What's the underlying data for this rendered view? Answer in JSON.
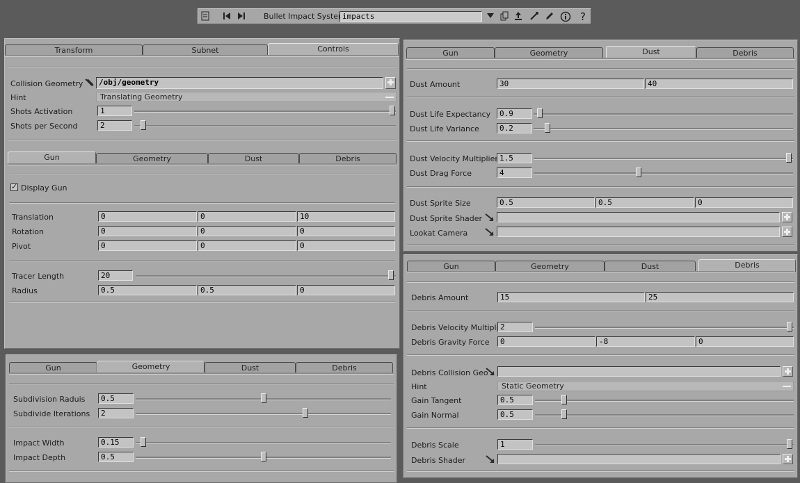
{
  "toolbar": {
    "node_type": "Bullet Impact System",
    "node_name": "impacts",
    "icons": [
      "network-icon",
      "first-icon",
      "last-icon",
      "dropdown-icon",
      "copy-icon",
      "upload-icon",
      "pipette-icon",
      "pencil-icon",
      "info-icon",
      "help-icon"
    ],
    "help_label": "?"
  },
  "main": {
    "tabs": [
      "Transform",
      "Subnet",
      "Controls"
    ],
    "active_tab": "Controls",
    "collision_geometry": {
      "label": "Collision Geometry",
      "value": "/obj/geometry"
    },
    "hint": {
      "label": "Hint",
      "value": "Translating Geometry"
    },
    "shots_activation": {
      "label": "Shots Activation",
      "value": "1",
      "level": 1.0
    },
    "shots_per_second": {
      "label": "Shots per Second",
      "value": "2",
      "level": 0.03
    }
  },
  "gun_panel": {
    "tabs": [
      "Gun",
      "Geometry",
      "Dust",
      "Debris"
    ],
    "active_tab": "Gun",
    "display_gun": {
      "label": "Display Gun",
      "checked": true,
      "mark": "✓"
    },
    "translation": {
      "label": "Translation",
      "values": [
        "0",
        "0",
        "10"
      ]
    },
    "rotation": {
      "label": "Rotation",
      "values": [
        "0",
        "0",
        "0"
      ]
    },
    "pivot": {
      "label": "Pivot",
      "values": [
        "0",
        "0",
        "0"
      ]
    },
    "tracer_length": {
      "label": "Tracer Length",
      "value": "20",
      "level": 1.0
    },
    "radius": {
      "label": "Radius",
      "values": [
        "0.5",
        "0.5",
        "0"
      ]
    }
  },
  "geometry_panel": {
    "tabs": [
      "Gun",
      "Geometry",
      "Dust",
      "Debris"
    ],
    "active_tab": "Geometry",
    "subdivision_radius": {
      "label": "Subdivision Raduis",
      "value": "0.5",
      "level": 0.5
    },
    "subdivide_iterations": {
      "label": "Subdivide Iterations",
      "value": "2",
      "level": 0.67
    },
    "impact_width": {
      "label": "Impact Width",
      "value": "0.15",
      "level": 0.02
    },
    "impact_depth": {
      "label": "Impact Depth",
      "value": "0.5",
      "level": 0.5
    }
  },
  "dust_panel": {
    "tabs": [
      "Gun",
      "Geometry",
      "Dust",
      "Debris"
    ],
    "active_tab": "Dust",
    "dust_amount": {
      "label": "Dust Amount",
      "values": [
        "30",
        "40"
      ]
    },
    "life_expectancy": {
      "label": "Dust Life Expectancy",
      "value": "0.9",
      "level": 0.02
    },
    "life_variance": {
      "label": "Dust Life Variance",
      "value": "0.2",
      "level": 0.05
    },
    "velocity_multiplier": {
      "label": "Dust Velocity Multiplier",
      "value": "1.5",
      "level": 1.0
    },
    "drag_force": {
      "label": "Dust Drag Force",
      "value": "4",
      "level": 0.4
    },
    "sprite_size": {
      "label": "Dust Sprite Size",
      "values": [
        "0.5",
        "0.5",
        "0"
      ]
    },
    "sprite_shader": {
      "label": "Dust Sprite Shader",
      "value": ""
    },
    "lookat_camera": {
      "label": "Lookat Camera",
      "value": ""
    }
  },
  "debris_panel": {
    "tabs": [
      "Gun",
      "Geometry",
      "Dust",
      "Debris"
    ],
    "active_tab": "Debris",
    "debris_amount": {
      "label": "Debris Amount",
      "values": [
        "15",
        "25"
      ]
    },
    "velocity_multiplier": {
      "label": "Debris Velocity Multiplier",
      "value": "2",
      "level": 1.0
    },
    "gravity_force": {
      "label": "Debris Gravity Force",
      "values": [
        "0",
        "-8",
        "0"
      ]
    },
    "collision_geo": {
      "label": "Debris Collision Geo",
      "value": ""
    },
    "hint": {
      "label": "Hint",
      "value": "Static Geometry"
    },
    "gain_tangent": {
      "label": "Gain Tangent",
      "value": "0.5",
      "level": 0.1
    },
    "gain_normal": {
      "label": "Gain Normal",
      "value": "0.5",
      "level": 0.1
    },
    "debris_scale": {
      "label": "Debris Scale",
      "value": "1",
      "level": 1.0
    },
    "debris_shader": {
      "label": "Debris Shader",
      "value": ""
    }
  }
}
